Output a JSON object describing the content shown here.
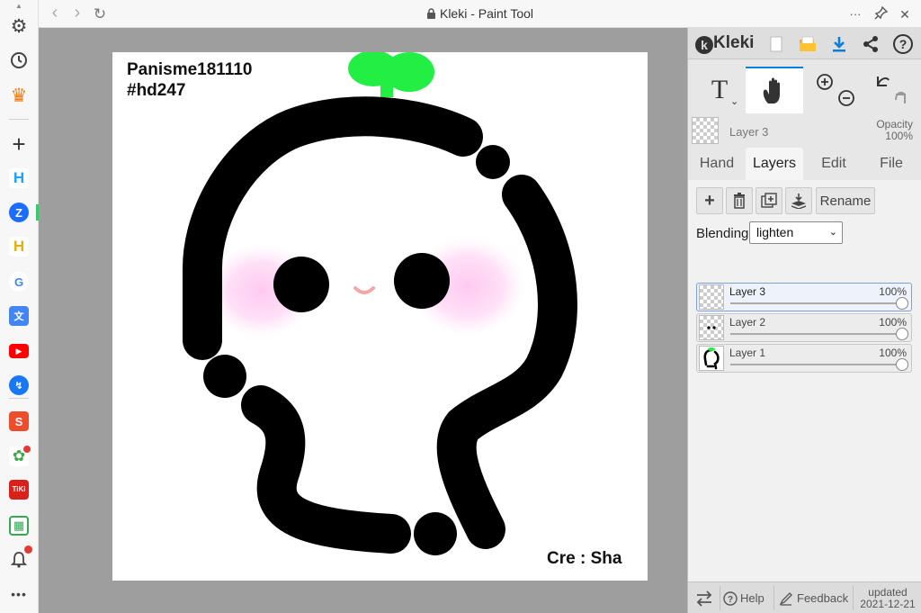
{
  "window": {
    "title": "Kleki - Paint Tool",
    "nav_back": "‹",
    "nav_forward": "›",
    "reload": "↻",
    "more": "···",
    "pin": "⌖",
    "close": "✕"
  },
  "sidebar": {
    "items": [
      {
        "name": "settings",
        "glyph": "⚙"
      },
      {
        "name": "history",
        "glyph": "⟲"
      },
      {
        "name": "crown",
        "glyph": "♛"
      },
      {
        "name": "add",
        "glyph": "+"
      },
      {
        "name": "app-h-1",
        "glyph": "H"
      },
      {
        "name": "app-zalo",
        "glyph": "Z"
      },
      {
        "name": "app-h-2",
        "glyph": "H"
      },
      {
        "name": "app-google",
        "glyph": "G"
      },
      {
        "name": "app-translate",
        "glyph": "文"
      },
      {
        "name": "app-youtube",
        "glyph": "▶"
      },
      {
        "name": "app-messenger",
        "glyph": "↯"
      },
      {
        "name": "app-shopee",
        "glyph": "S"
      },
      {
        "name": "app-maps",
        "glyph": "✿"
      },
      {
        "name": "app-tiki",
        "glyph": "TiKi"
      },
      {
        "name": "app-sheets",
        "glyph": "▦"
      },
      {
        "name": "notifications",
        "glyph": "🔔"
      },
      {
        "name": "more",
        "glyph": "···"
      }
    ]
  },
  "canvas": {
    "title_line1": "Panisme181110",
    "title_line2": "#hd247",
    "credit": "Cre : Sha"
  },
  "panel": {
    "logo": "Kleki",
    "layer_name": "Layer 3",
    "opacity_label": "Opacity",
    "opacity_value": "100%",
    "tool_text": "T",
    "tabs": [
      "Hand",
      "Layers",
      "Edit",
      "File"
    ],
    "active_tab": "Layers",
    "rename_label": "Rename",
    "blending_label": "Blending",
    "blending_value": "lighten",
    "layers": [
      {
        "name": "Layer 3",
        "opacity": "100%",
        "opacity_value": 1.0,
        "selected": true
      },
      {
        "name": "Layer 2",
        "opacity": "100%",
        "opacity_value": 1.0,
        "selected": false
      },
      {
        "name": "Layer 1",
        "opacity": "100%",
        "opacity_value": 1.0,
        "selected": false
      }
    ],
    "footer": {
      "help": "Help",
      "feedback": "Feedback",
      "updated_label": "updated",
      "updated_date": "2021-12-21"
    }
  },
  "colors": {
    "accent": "#0a7fd9",
    "green_sprout": "#22ee44",
    "blush": "#ffc8ee",
    "mouth": "#f3a8a8"
  }
}
